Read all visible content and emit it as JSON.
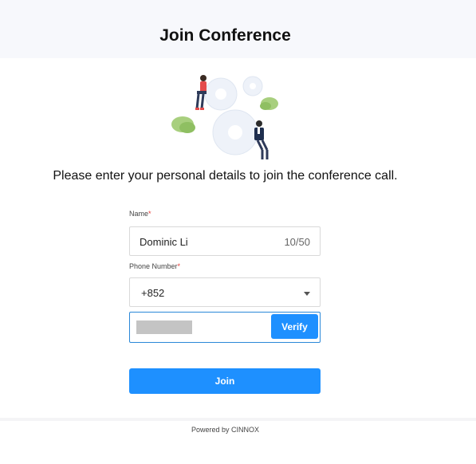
{
  "header": {
    "title": "Join Conference"
  },
  "intro": {
    "text": "Please enter your personal details to join the conference call."
  },
  "form": {
    "name": {
      "label": "Name",
      "required_mark": "*",
      "value": "Dominic Li",
      "counter": "10/50"
    },
    "phone": {
      "label": "Phone Number",
      "required_mark": "*",
      "country_code": "+852",
      "number_value": ""
    },
    "verify_label": "Verify",
    "join_label": "Join"
  },
  "footer": {
    "text": "Powered by CINNOX"
  },
  "colors": {
    "accent": "#1e90ff",
    "required": "#e53935",
    "header_bg": "#f7f8fc"
  },
  "illustration": {
    "icon": "conference-people-gears-illustration"
  }
}
